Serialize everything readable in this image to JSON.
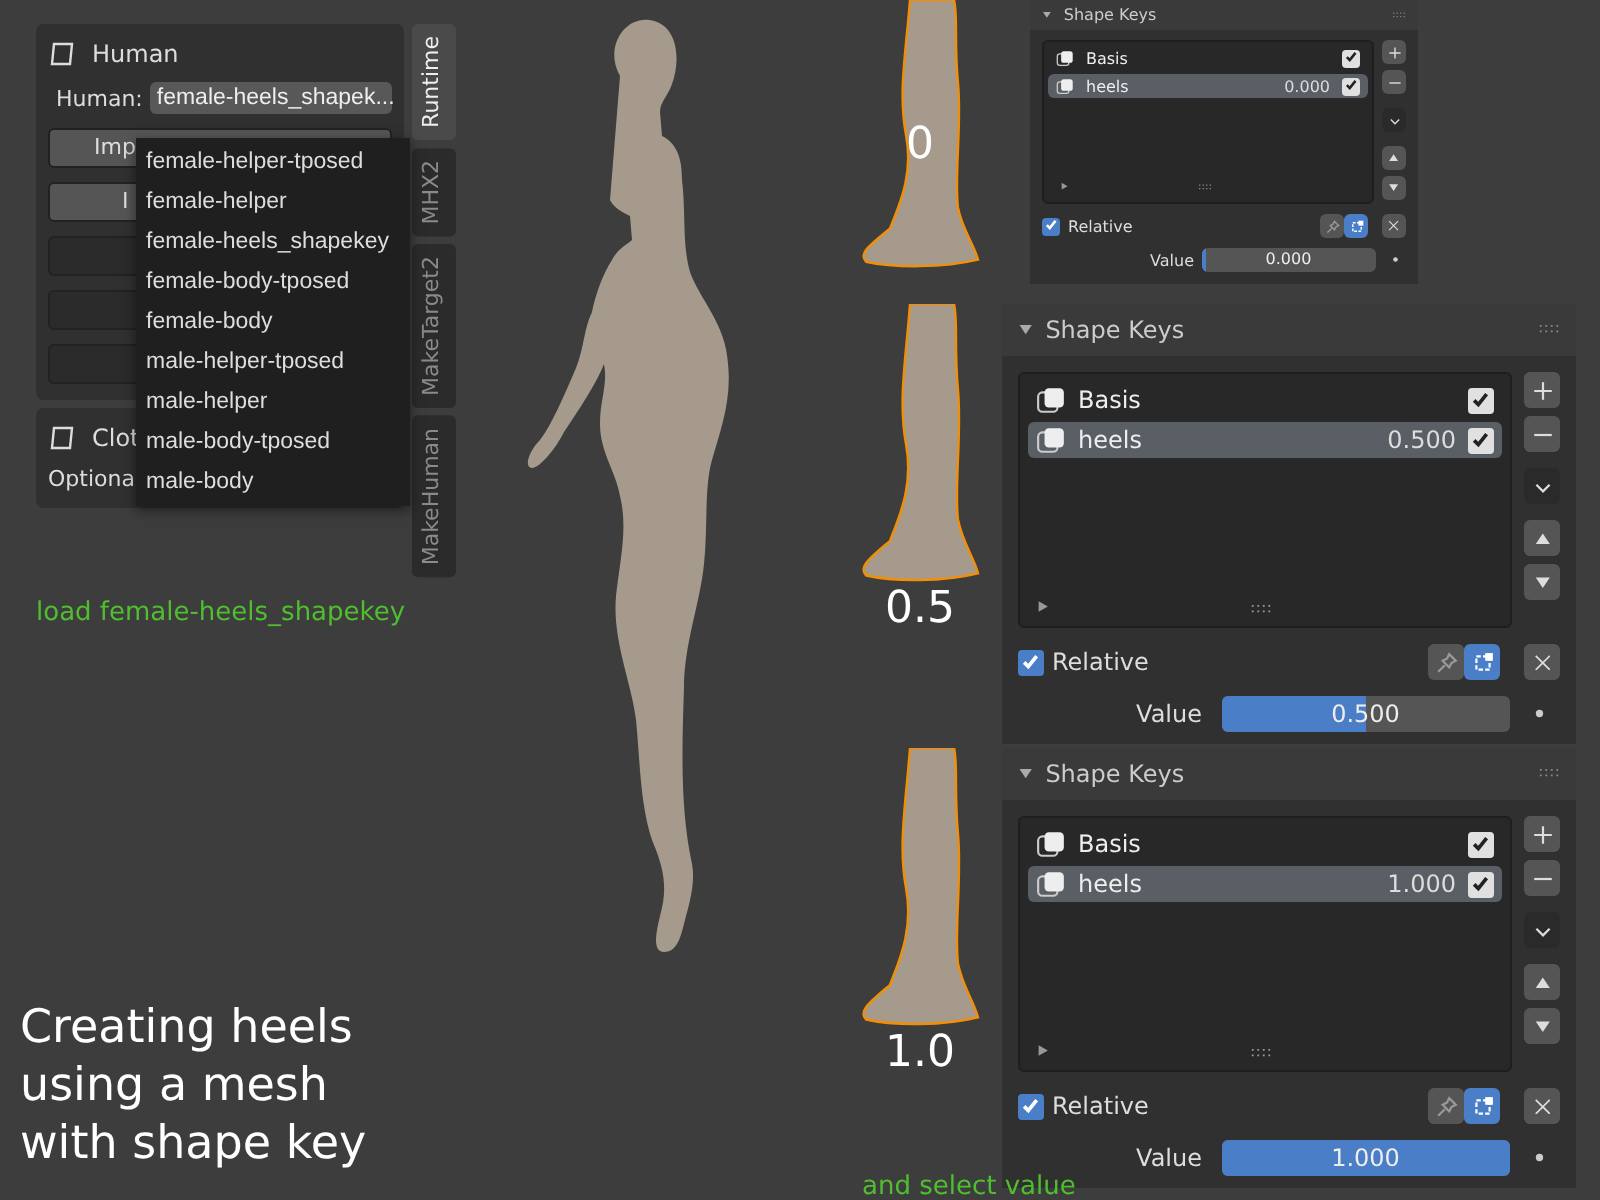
{
  "human_panel": {
    "title": "Human",
    "field_label": "Human:",
    "field_value": "female-heels_shapek...",
    "buttons": [
      {
        "label": "Imp"
      },
      {
        "label": "I"
      }
    ]
  },
  "clothes_panel": {
    "title": "Clot",
    "hint": "Optiona"
  },
  "sidebar_tabs": [
    {
      "label": "Runtime",
      "selected": true
    },
    {
      "label": "MHX2",
      "selected": false
    },
    {
      "label": "MakeTarget2",
      "selected": false
    },
    {
      "label": "MakeHuman",
      "selected": false
    }
  ],
  "dropdown": {
    "items": [
      "female-helper-tposed",
      "female-helper",
      "female-heels_shapekey",
      "female-body-tposed",
      "female-body",
      "male-helper-tposed",
      "male-helper",
      "male-body-tposed",
      "male-body"
    ]
  },
  "caption_left": "load female-heels_shapekey",
  "title_lines": [
    "Creating heels",
    "using a mesh",
    "with shape key"
  ],
  "states": [
    {
      "label": "0",
      "panel": {
        "title": "Shape Keys",
        "keys": [
          {
            "name": "Basis",
            "checked": true,
            "selected": false
          },
          {
            "name": "heels",
            "value": "0.000",
            "checked": true,
            "selected": true
          }
        ],
        "relative": {
          "label": "Relative",
          "checked": true
        },
        "value_label": "Value",
        "value": "0.000",
        "level": 0
      }
    },
    {
      "label": "0.5",
      "panel": {
        "title": "Shape Keys",
        "keys": [
          {
            "name": "Basis",
            "checked": true,
            "selected": false
          },
          {
            "name": "heels",
            "value": "0.500",
            "checked": true,
            "selected": true
          }
        ],
        "relative": {
          "label": "Relative",
          "checked": true
        },
        "value_label": "Value",
        "value": "0.500",
        "level": 0.5
      }
    },
    {
      "label": "1.0",
      "panel": {
        "title": "Shape Keys",
        "keys": [
          {
            "name": "Basis",
            "checked": true,
            "selected": false
          },
          {
            "name": "heels",
            "value": "1.000",
            "checked": true,
            "selected": true
          }
        ],
        "relative": {
          "label": "Relative",
          "checked": true
        },
        "value_label": "Value",
        "value": "1.000",
        "level": 1
      }
    }
  ],
  "caption_right": "and select value"
}
